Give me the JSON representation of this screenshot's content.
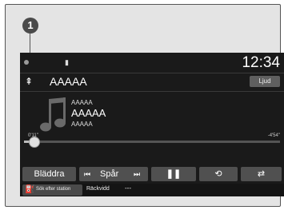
{
  "callout": "1",
  "status": {
    "clock": "12:34"
  },
  "source": {
    "title": "AAAAA",
    "sound_button": "Ljud"
  },
  "track": {
    "line1": "AAAAA",
    "line2": "AAAAA",
    "line3": "AAAAA",
    "elapsed": "0'11\"",
    "remaining": "-4'54\"",
    "progress_fraction": 0.036
  },
  "controls": {
    "browse": "Bläddra",
    "track_label": "Spår"
  },
  "footer": {
    "fuel_label": "Sök efter station",
    "range_label": "Räckvidd",
    "range_value": "---"
  },
  "icons": [
    "status-dot-icon",
    "usb-icon",
    "music-note-icon",
    "skip-back-icon",
    "skip-forward-icon",
    "pause-icon",
    "repeat-icon",
    "shuffle-icon",
    "fuel-pump-icon"
  ]
}
